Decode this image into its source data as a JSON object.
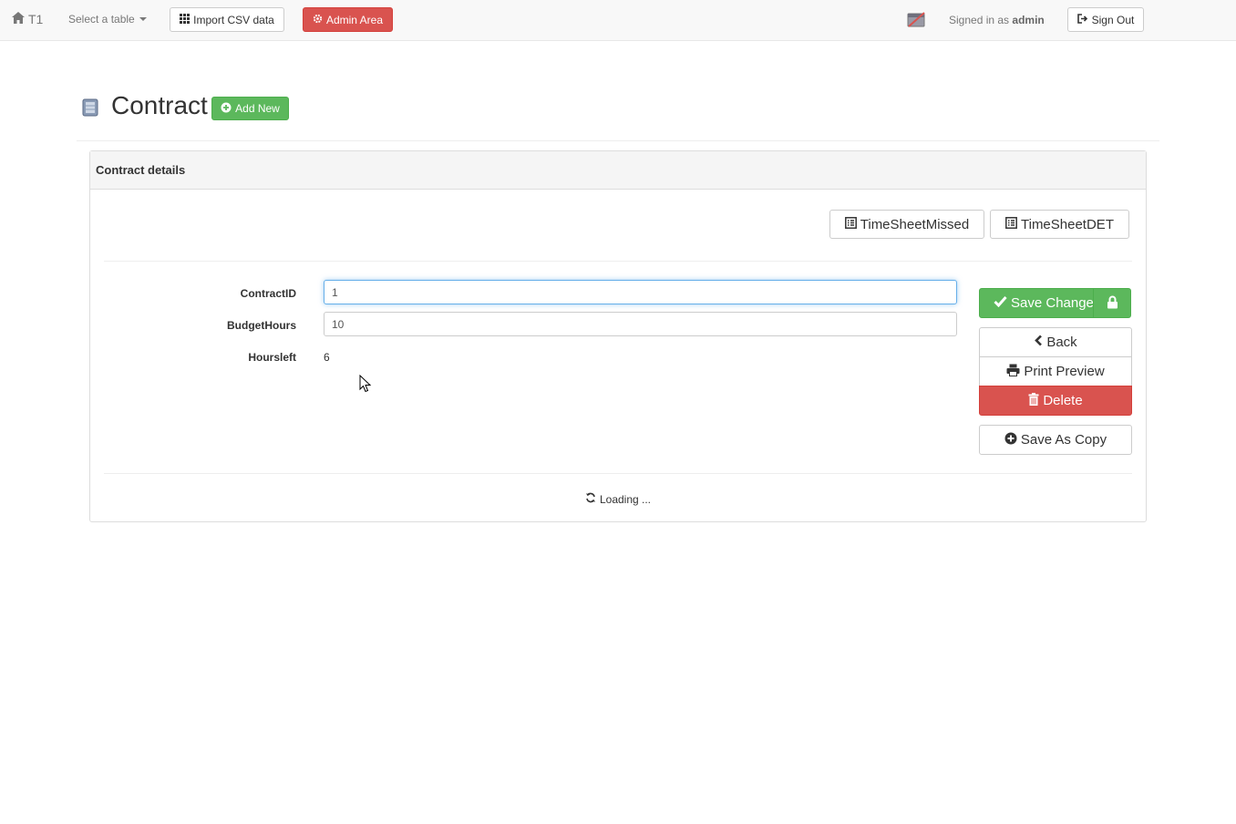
{
  "navbar": {
    "brand": "T1",
    "select_table": "Select a table",
    "import_csv": "Import CSV data",
    "admin_area": "Admin Area",
    "signed_in_prefix": "Signed in as",
    "username": "admin",
    "sign_out": "Sign Out"
  },
  "header": {
    "title": "Contract",
    "add_new": "Add New"
  },
  "panel": {
    "heading": "Contract details",
    "children_buttons": [
      "TimeSheetMissed",
      "TimeSheetDET"
    ],
    "fields": [
      {
        "label": "ContractID",
        "value": "1"
      },
      {
        "label": "BudgetHours",
        "value": "10"
      },
      {
        "label": "Hoursleft",
        "value": "6"
      }
    ],
    "actions": {
      "save": "Save Change",
      "back": "Back",
      "print": "Print Preview",
      "delete": "Delete",
      "save_copy": "Save As Copy"
    },
    "loading": "Loading ..."
  },
  "colors": {
    "success": "#5cb85c",
    "danger": "#d9534f",
    "focus": "#66afe9"
  },
  "icons": [
    "home-icon",
    "th-icon",
    "cog-icon",
    "calendar-off-icon",
    "log-out-icon",
    "table-icon",
    "plus-circle-icon",
    "list-alt-icon",
    "check-icon",
    "lock-icon",
    "chevron-left-icon",
    "print-icon",
    "trash-icon",
    "refresh-icon"
  ]
}
